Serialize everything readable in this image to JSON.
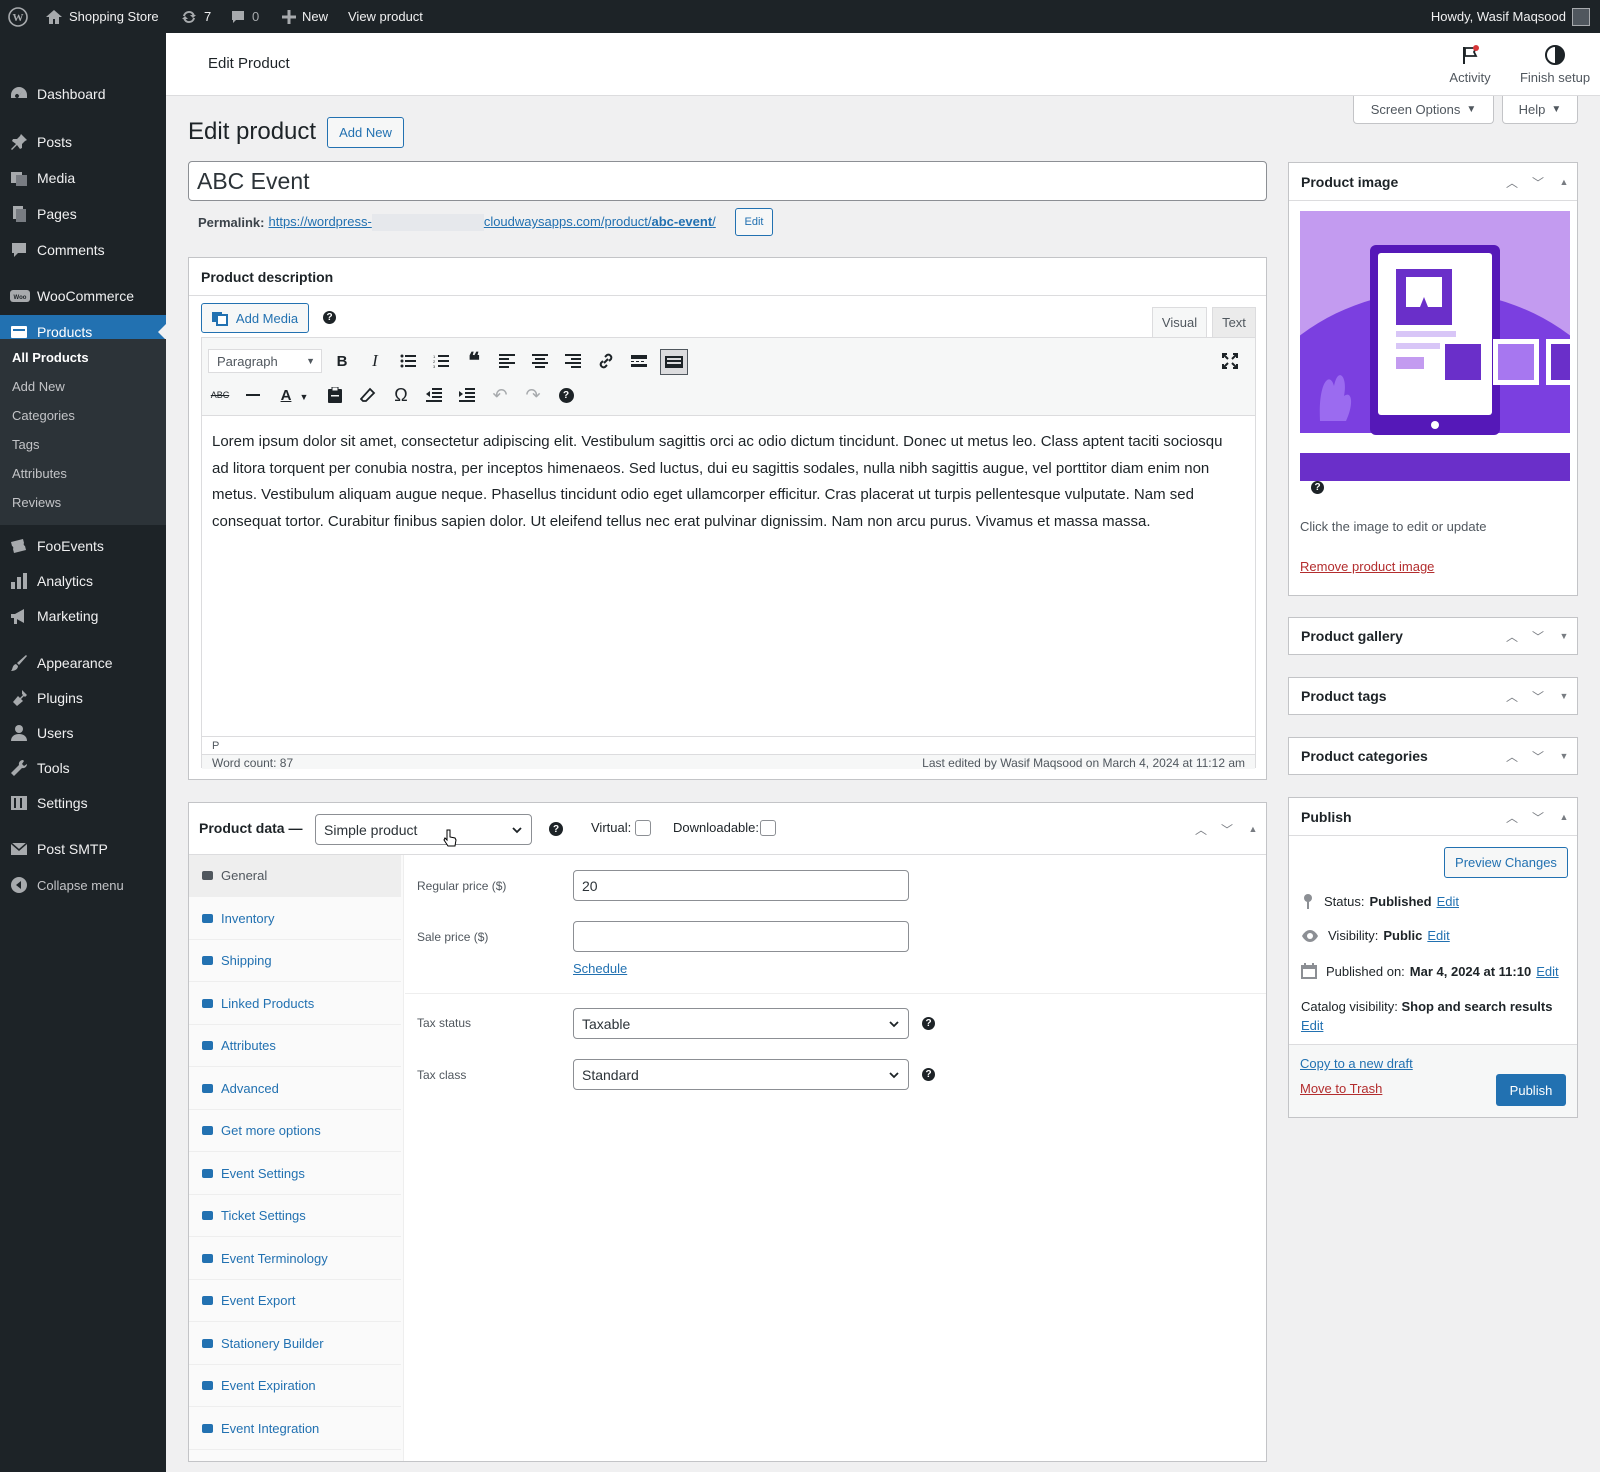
{
  "adminbar": {
    "site": "Shopping Store",
    "updates": "7",
    "comments": "0",
    "new": "New",
    "view": "View product",
    "howdy": "Howdy, Wasif Maqsood"
  },
  "sidebar": {
    "items": [
      {
        "label": "Dashboard",
        "icon": "dashboard-icon"
      },
      {
        "label": "Posts",
        "icon": "pin-icon"
      },
      {
        "label": "Media",
        "icon": "media-icon"
      },
      {
        "label": "Pages",
        "icon": "pages-icon"
      },
      {
        "label": "Comments",
        "icon": "comment-icon"
      },
      {
        "label": "WooCommerce",
        "icon": "woo-icon"
      },
      {
        "label": "Products",
        "icon": "products-icon"
      },
      {
        "label": "FooEvents",
        "icon": "ticket-icon"
      },
      {
        "label": "Analytics",
        "icon": "bar-chart-icon"
      },
      {
        "label": "Marketing",
        "icon": "megaphone-icon"
      },
      {
        "label": "Appearance",
        "icon": "brush-icon"
      },
      {
        "label": "Plugins",
        "icon": "plugin-icon"
      },
      {
        "label": "Users",
        "icon": "user-icon"
      },
      {
        "label": "Tools",
        "icon": "wrench-icon"
      },
      {
        "label": "Settings",
        "icon": "sliders-icon"
      },
      {
        "label": "Post SMTP",
        "icon": "mail-icon"
      },
      {
        "label": "Collapse menu",
        "icon": "collapse-icon"
      }
    ],
    "submenu": [
      "All Products",
      "Add New",
      "Categories",
      "Tags",
      "Attributes",
      "Reviews"
    ]
  },
  "header": {
    "title": "Edit Product",
    "activity": "Activity",
    "finish": "Finish setup",
    "screen_options": "Screen Options",
    "help": "Help"
  },
  "page": {
    "heading": "Edit product",
    "add_new": "Add New",
    "title_value": "ABC Event",
    "permalink_label": "Permalink:",
    "permalink_a": "https://wordpress-",
    "permalink_b": "cloudwaysapps.com/product/",
    "permalink_slug": "abc-event",
    "permalink_end": "/",
    "permalink_edit": "Edit"
  },
  "description": {
    "title": "Product description",
    "add_media": "Add Media",
    "tab_visual": "Visual",
    "tab_text": "Text",
    "format": "Paragraph",
    "body": "Lorem ipsum dolor sit amet, consectetur adipiscing elit. Vestibulum sagittis orci ac odio dictum tincidunt. Donec ut metus leo. Class aptent taciti sociosqu ad litora torquent per conubia nostra, per inceptos himenaeos. Sed luctus, dui eu sagittis sodales, nulla nibh sagittis augue, vel porttitor diam enim non metus. Vestibulum aliquam augue neque. Phasellus tincidunt odio eget ullamcorper efficitur. Cras placerat ut turpis pellentesque vulputate. Nam sed consequat tortor. Curabitur finibus sapien dolor. Ut eleifend tellus nec erat pulvinar dignissim. Nam non arcu purus. Vivamus et massa massa.",
    "path": "P",
    "word_count": "Word count: 87",
    "last_edited": "Last edited by Wasif Maqsood on March 4, 2024 at 11:12 am"
  },
  "product_data": {
    "label": "Product data —",
    "type": "Simple product",
    "virtual": "Virtual:",
    "downloadable": "Downloadable:",
    "tabs": [
      "General",
      "Inventory",
      "Shipping",
      "Linked Products",
      "Attributes",
      "Advanced",
      "Get more options",
      "Event Settings",
      "Ticket Settings",
      "Event Terminology",
      "Event Export",
      "Stationery Builder",
      "Event Expiration",
      "Event Integration"
    ],
    "regular_label": "Regular price ($)",
    "regular_value": "20",
    "sale_label": "Sale price ($)",
    "sale_value": "",
    "schedule": "Schedule",
    "tax_status_label": "Tax status",
    "tax_status": "Taxable",
    "tax_class_label": "Tax class",
    "tax_class": "Standard"
  },
  "right": {
    "image_title": "Product image",
    "image_hint": "Click the image to edit or update",
    "remove_image": "Remove product image",
    "gallery": "Product gallery",
    "tags": "Product tags",
    "categories": "Product categories",
    "publish": "Publish",
    "preview": "Preview Changes",
    "status_label": "Status:",
    "status": "Published",
    "visibility_label": "Visibility:",
    "visibility": "Public",
    "published_label": "Published on:",
    "published": "Mar 4, 2024 at 11:10",
    "catalog_label": "Catalog visibility:",
    "catalog": "Shop and search results",
    "edit": "Edit",
    "copy_draft": "Copy to a new draft",
    "trash": "Move to Trash",
    "publish_btn": "Publish"
  },
  "colors": {
    "accent": "#2271b1",
    "sidebar": "#1d2327",
    "image_bg": "#9b5de5"
  }
}
